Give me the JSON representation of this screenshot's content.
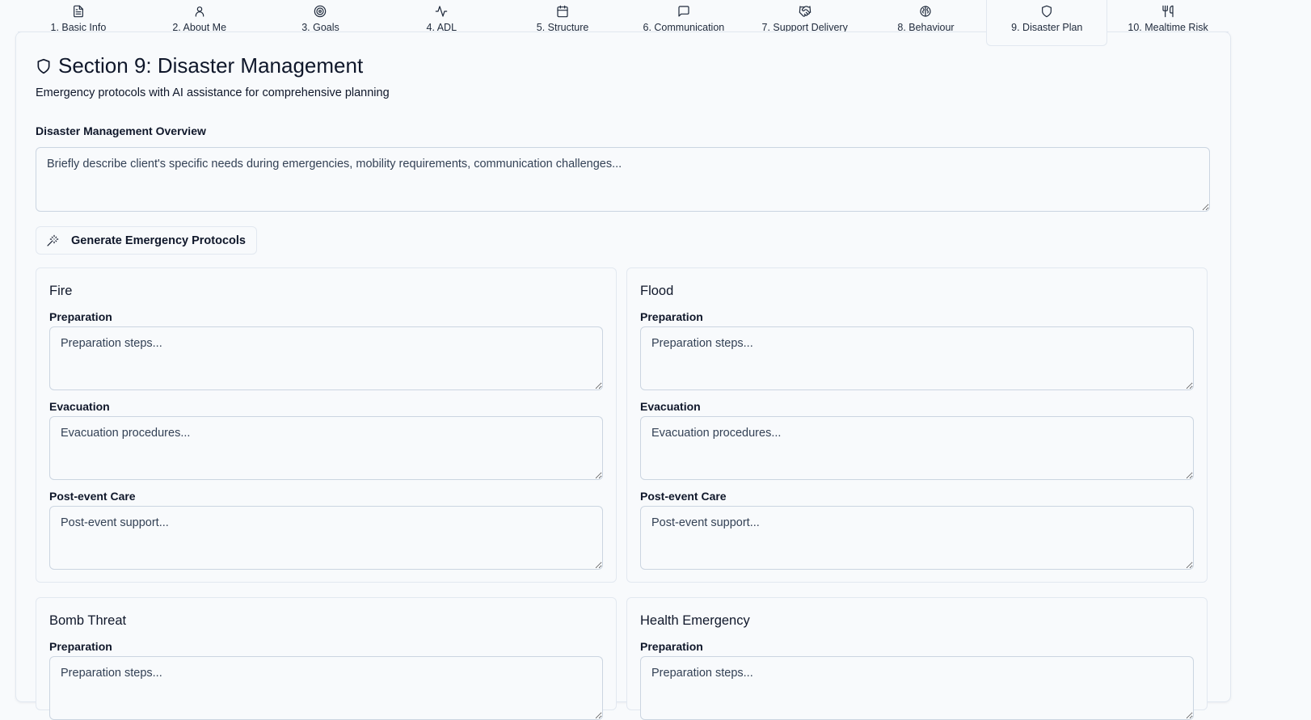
{
  "tabs": [
    {
      "label": "1. Basic Info",
      "icon": "document-icon"
    },
    {
      "label": "2. About Me",
      "icon": "user-icon"
    },
    {
      "label": "3. Goals",
      "icon": "target-icon"
    },
    {
      "label": "4. ADL",
      "icon": "activity-icon"
    },
    {
      "label": "5. Structure",
      "icon": "calendar-icon"
    },
    {
      "label": "6. Communication",
      "icon": "message-icon"
    },
    {
      "label": "7. Support Delivery",
      "icon": "handshake-icon"
    },
    {
      "label": "8. Behaviour",
      "icon": "brain-icon"
    },
    {
      "label": "9. Disaster Plan",
      "icon": "shield-icon"
    },
    {
      "label": "10. Mealtime Risk",
      "icon": "utensils-icon"
    }
  ],
  "active_tab": "9. Disaster Plan",
  "section": {
    "title": "Section 9: Disaster Management",
    "subtitle": "Emergency protocols with AI assistance for comprehensive planning",
    "icon": "shield-icon"
  },
  "overview": {
    "label": "Disaster Management Overview",
    "placeholder": "Briefly describe client's specific needs during emergencies, mobility requirements, communication challenges...",
    "value": ""
  },
  "generate_button": {
    "label": "Generate Emergency Protocols",
    "icon": "magic-wand-icon"
  },
  "disasters": [
    {
      "title": "Fire",
      "preparation": {
        "label": "Preparation",
        "placeholder": "Preparation steps...",
        "value": ""
      },
      "evacuation": {
        "label": "Evacuation",
        "placeholder": "Evacuation procedures...",
        "value": ""
      },
      "post_event": {
        "label": "Post-event Care",
        "placeholder": "Post-event support...",
        "value": ""
      }
    },
    {
      "title": "Flood",
      "preparation": {
        "label": "Preparation",
        "placeholder": "Preparation steps...",
        "value": ""
      },
      "evacuation": {
        "label": "Evacuation",
        "placeholder": "Evacuation procedures...",
        "value": ""
      },
      "post_event": {
        "label": "Post-event Care",
        "placeholder": "Post-event support...",
        "value": ""
      }
    },
    {
      "title": "Bomb Threat",
      "preparation": {
        "label": "Preparation",
        "placeholder": "Preparation steps...",
        "value": ""
      }
    },
    {
      "title": "Health Emergency",
      "preparation": {
        "label": "Preparation",
        "placeholder": "Preparation steps...",
        "value": ""
      }
    }
  ],
  "colors": {
    "background": "#f8fafc",
    "text": "#0f172a",
    "border": "#e2e8f0",
    "input_border": "#cbd5e1",
    "placeholder": "#334155"
  }
}
